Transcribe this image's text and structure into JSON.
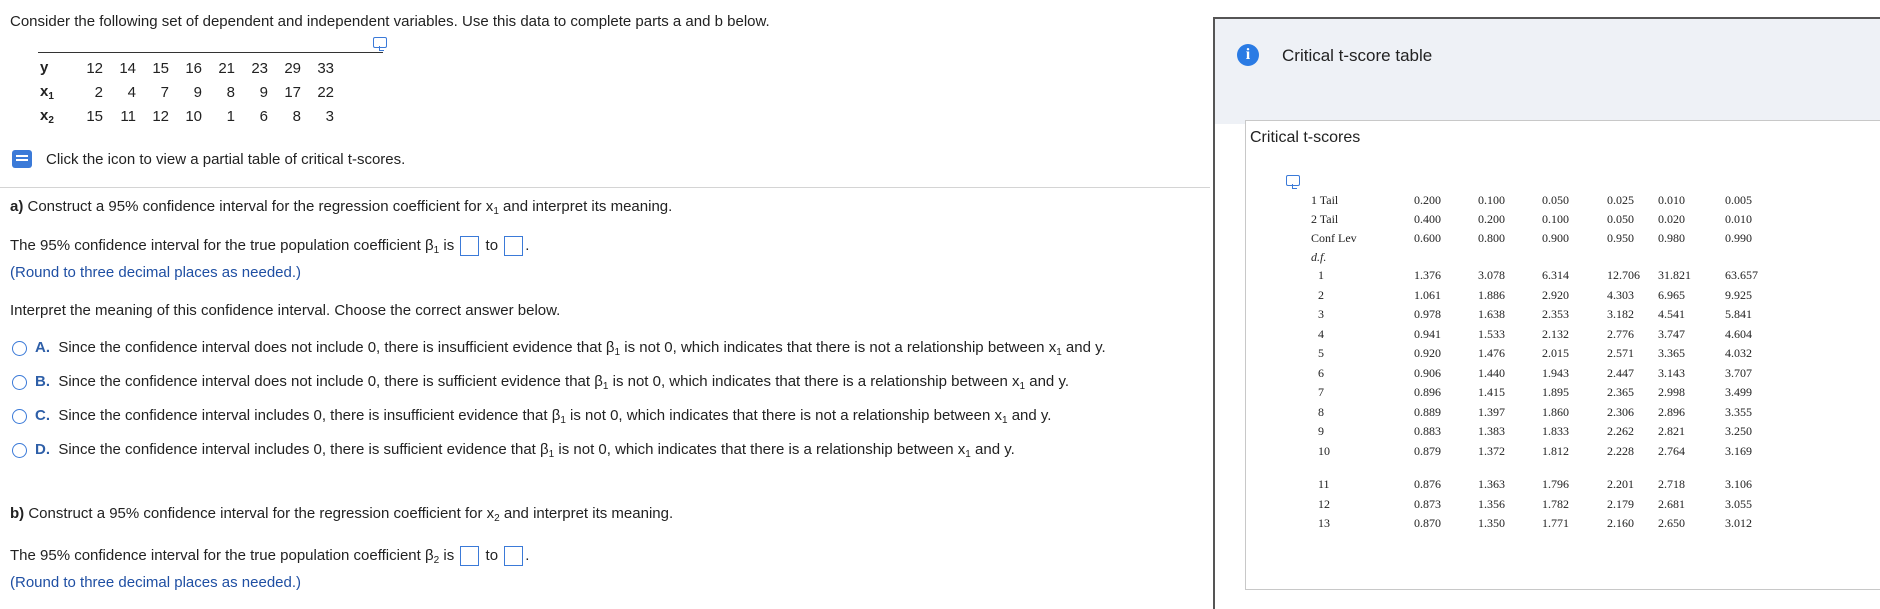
{
  "question": {
    "intro": "Consider the following set of dependent and independent variables. Use this data to complete parts a and b below.",
    "table": {
      "rows": [
        {
          "label": "y",
          "sub": "",
          "values": [
            "12",
            "14",
            "15",
            "16",
            "21",
            "23",
            "29",
            "33"
          ]
        },
        {
          "label": "x",
          "sub": "1",
          "values": [
            "2",
            "4",
            "7",
            "9",
            "8",
            "9",
            "17",
            "22"
          ]
        },
        {
          "label": "x",
          "sub": "2",
          "values": [
            "15",
            "11",
            "12",
            "10",
            "1",
            "6",
            "8",
            "3"
          ]
        }
      ]
    },
    "icon_note": "Click the icon to view a partial table of critical t-scores.",
    "part_a": {
      "letter": "a)",
      "title_pre": " Construct a 95% confidence interval for the regression coefficient for x",
      "title_sub": "1",
      "title_post": " and interpret its meaning.",
      "ci_pre": "The 95% confidence interval for the true population coefficient β",
      "ci_sub": "1",
      "ci_is": " is",
      "ci_to": "to",
      "round_note": "(Round to three decimal places as needed.)",
      "interpret_prompt": "Interpret the meaning of this confidence interval. Choose the correct answer below.",
      "options": [
        {
          "letter": "A.",
          "parts": [
            "Since the confidence interval does not include 0, there is insufficient evidence that β",
            "1",
            " is not 0, which indicates that there is not a relationship between x",
            "1",
            " and y."
          ]
        },
        {
          "letter": "B.",
          "parts": [
            "Since the confidence interval does not include 0, there is sufficient evidence that β",
            "1",
            " is not 0, which indicates that there is a relationship between x",
            "1",
            " and y."
          ]
        },
        {
          "letter": "C.",
          "parts": [
            "Since the confidence interval includes 0, there is insufficient evidence that β",
            "1",
            " is not 0, which indicates that there is not a relationship between x",
            "1",
            " and y."
          ]
        },
        {
          "letter": "D.",
          "parts": [
            "Since the confidence interval includes 0, there is sufficient evidence that β",
            "1",
            " is not 0, which indicates that there is a relationship between x",
            "1",
            " and y."
          ]
        }
      ]
    },
    "part_b": {
      "letter": "b)",
      "title_pre": " Construct a 95% confidence interval for the regression coefficient for x",
      "title_sub": "2",
      "title_post": " and interpret its meaning.",
      "ci_pre": "The 95% confidence interval for the true population coefficient β",
      "ci_sub": "2",
      "ci_is": " is",
      "ci_to": "to",
      "round_note": "(Round to three decimal places as needed.)"
    }
  },
  "popup": {
    "title": "Critical t-score table",
    "inner_title": "Critical t-scores",
    "rows_header": [
      {
        "label": "1 Tail",
        "values": [
          "0.200",
          "0.100",
          "0.050",
          "0.025",
          "0.010",
          "0.005"
        ]
      },
      {
        "label": "2 Tail",
        "values": [
          "0.400",
          "0.200",
          "0.100",
          "0.050",
          "0.020",
          "0.010"
        ]
      },
      {
        "label": "Conf Lev",
        "values": [
          "0.600",
          "0.800",
          "0.900",
          "0.950",
          "0.980",
          "0.990"
        ]
      }
    ],
    "df_label": "d.f.",
    "rows": [
      {
        "df": "1",
        "values": [
          "1.376",
          "3.078",
          "6.314",
          "12.706",
          "31.821",
          "63.657"
        ]
      },
      {
        "df": "2",
        "values": [
          "1.061",
          "1.886",
          "2.920",
          "4.303",
          "6.965",
          "9.925"
        ]
      },
      {
        "df": "3",
        "values": [
          "0.978",
          "1.638",
          "2.353",
          "3.182",
          "4.541",
          "5.841"
        ]
      },
      {
        "df": "4",
        "values": [
          "0.941",
          "1.533",
          "2.132",
          "2.776",
          "3.747",
          "4.604"
        ]
      },
      {
        "df": "5",
        "values": [
          "0.920",
          "1.476",
          "2.015",
          "2.571",
          "3.365",
          "4.032"
        ]
      },
      {
        "df": "6",
        "values": [
          "0.906",
          "1.440",
          "1.943",
          "2.447",
          "3.143",
          "3.707"
        ]
      },
      {
        "df": "7",
        "values": [
          "0.896",
          "1.415",
          "1.895",
          "2.365",
          "2.998",
          "3.499"
        ]
      },
      {
        "df": "8",
        "values": [
          "0.889",
          "1.397",
          "1.860",
          "2.306",
          "2.896",
          "3.355"
        ]
      },
      {
        "df": "9",
        "values": [
          "0.883",
          "1.383",
          "1.833",
          "2.262",
          "2.821",
          "3.250"
        ]
      },
      {
        "df": "10",
        "values": [
          "0.879",
          "1.372",
          "1.812",
          "2.228",
          "2.764",
          "3.169"
        ]
      },
      {
        "df": "11",
        "values": [
          "0.876",
          "1.363",
          "1.796",
          "2.201",
          "2.718",
          "3.106"
        ]
      },
      {
        "df": "12",
        "values": [
          "0.873",
          "1.356",
          "1.782",
          "2.179",
          "2.681",
          "3.055"
        ]
      },
      {
        "df": "13",
        "values": [
          "0.870",
          "1.350",
          "1.771",
          "2.160",
          "2.650",
          "3.012"
        ]
      }
    ]
  }
}
